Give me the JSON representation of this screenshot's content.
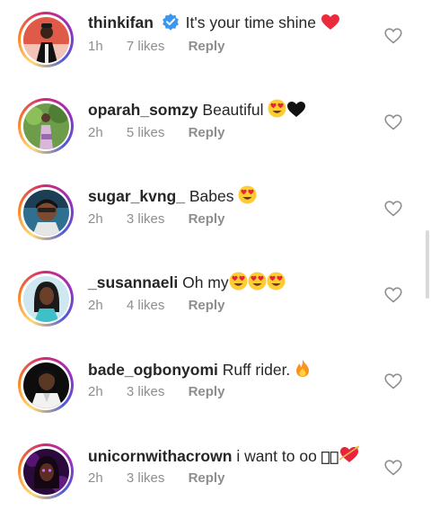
{
  "comments": [
    {
      "username": "thinkifan",
      "verified": true,
      "text": "It's your time shine",
      "emoji_suffix": [
        "red-heart"
      ],
      "time": "1h",
      "likes": "7 likes",
      "reply": "Reply"
    },
    {
      "username": "oparah_somzy",
      "verified": false,
      "text": "Beautiful",
      "emoji_suffix": [
        "heart-eyes",
        "black-heart"
      ],
      "time": "2h",
      "likes": "5 likes",
      "reply": "Reply"
    },
    {
      "username": "sugar_kvng_",
      "verified": false,
      "text": "Babes",
      "emoji_suffix": [
        "heart-eyes"
      ],
      "time": "2h",
      "likes": "3 likes",
      "reply": "Reply"
    },
    {
      "username": "_susannaeli",
      "verified": false,
      "text": "Oh my",
      "emoji_suffix": [
        "heart-eyes",
        "heart-eyes",
        "heart-eyes"
      ],
      "time": "2h",
      "likes": "4 likes",
      "reply": "Reply"
    },
    {
      "username": "bade_ogbonyomi",
      "verified": false,
      "text": "Ruff rider.",
      "emoji_suffix": [
        "fire"
      ],
      "time": "2h",
      "likes": "3 likes",
      "reply": "Reply"
    },
    {
      "username": "unicornwithacrown",
      "verified": false,
      "text": "i want to oo",
      "emoji_suffix": [
        "missing-glyph",
        "missing-glyph",
        "heart-with-arrow"
      ],
      "time": "2h",
      "likes": "3 likes",
      "reply": "Reply"
    }
  ],
  "colors": {
    "text": "#262626",
    "meta": "#8e8e8e",
    "verified_blue": "#3897f0",
    "heart_red": "#ed2a3c"
  }
}
